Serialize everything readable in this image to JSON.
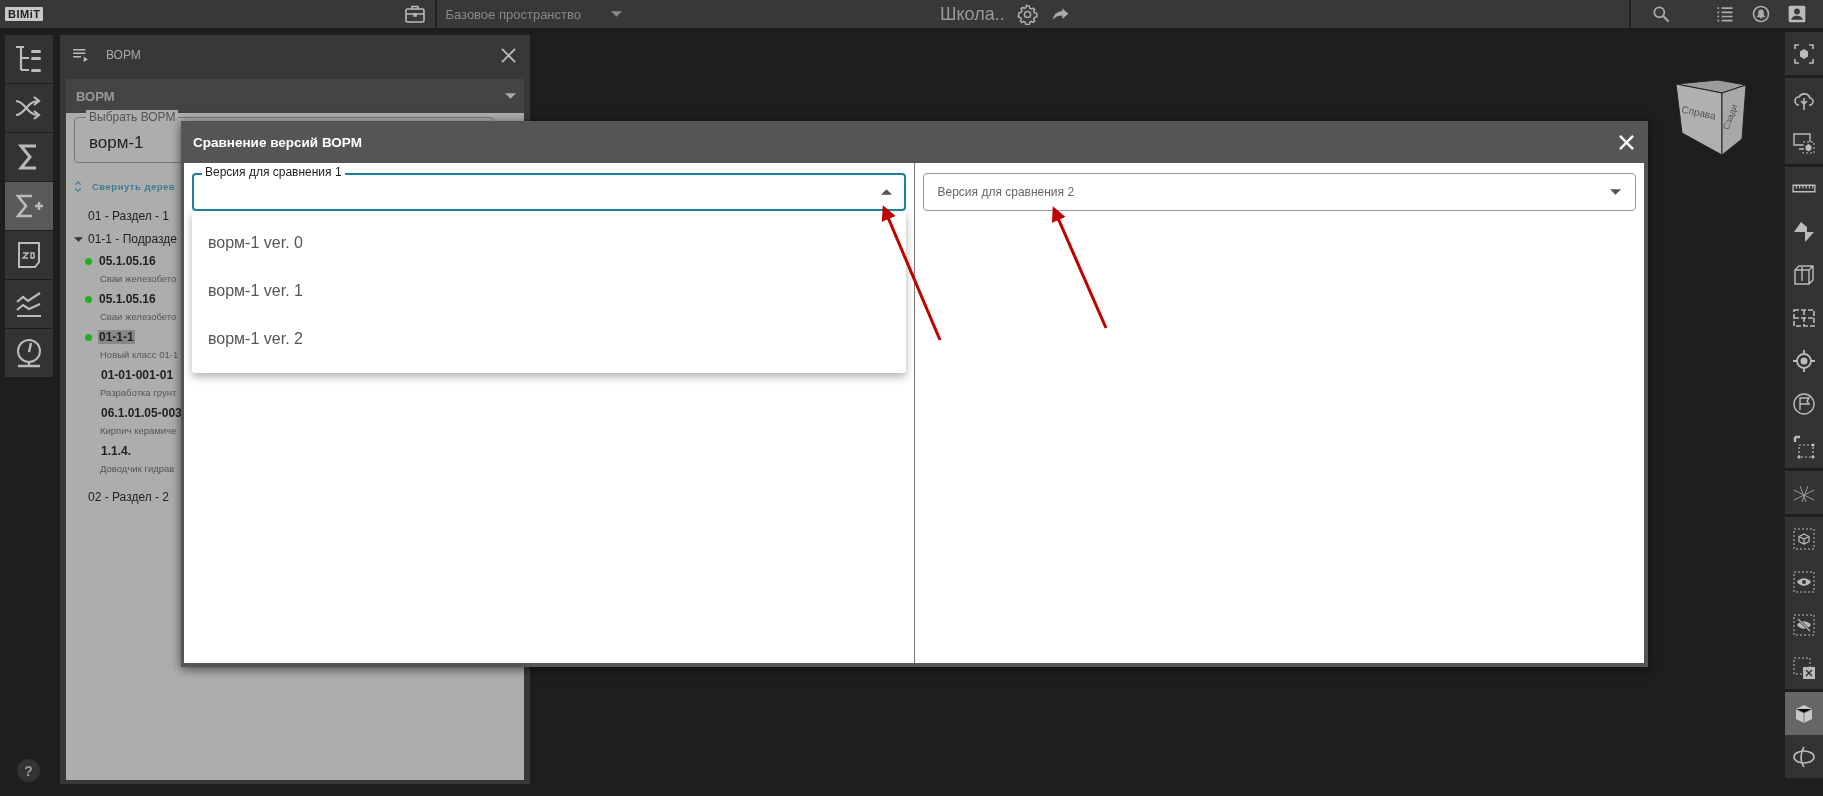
{
  "topbar": {
    "logo": "BIMiT",
    "workspace": "Базовое пространство",
    "project": "Школа.."
  },
  "left_rail": [
    {
      "kind": "tree",
      "selected": false
    },
    {
      "kind": "shuffle",
      "selected": false
    },
    {
      "kind": "sum",
      "selected": false
    },
    {
      "kind": "sumplus",
      "selected": true
    },
    {
      "kind": "plan2d",
      "selected": false
    },
    {
      "kind": "chart",
      "selected": false
    },
    {
      "kind": "gauge",
      "selected": false
    }
  ],
  "help": "?",
  "panel": {
    "title": "ВОРМ",
    "selector": "ВОРМ",
    "field_label": "Выбрать ВОРМ",
    "field_value": "ворм-1",
    "collapse_link": "Свернуть дерев",
    "tree": [
      {
        "kind": "section",
        "label": "01 - Раздел - 1"
      },
      {
        "kind": "group",
        "label": "01-1 - Подразде",
        "expanded": true,
        "children": [
          {
            "code": "05.1.05.16",
            "description": "Сваи железобето",
            "dot": true,
            "selected": false
          },
          {
            "code": "05.1.05.16",
            "description": "Сваи железобето",
            "dot": true,
            "selected": false
          },
          {
            "code": "01-1-1",
            "description": "Новый класс 01-1",
            "dot": true,
            "selected": true
          },
          {
            "code": "01-01-001-01",
            "description": "Разработка грунт",
            "dot": false,
            "selected": false
          },
          {
            "code": "06.1.01.05-003",
            "description": "Кирпич керамиче",
            "dot": false,
            "selected": false
          },
          {
            "code": "1.1.4.",
            "description": "Доводчик гидрав",
            "dot": false,
            "selected": false
          }
        ]
      },
      {
        "kind": "section",
        "label": "02 - Раздел - 2"
      }
    ]
  },
  "view_cube": {
    "faces": [
      "Справа",
      "Сзади"
    ]
  },
  "right_rail": [
    {
      "items": [
        {
          "kind": "focus"
        }
      ]
    },
    {
      "items": [
        {
          "kind": "cloud"
        },
        {
          "kind": "screen"
        }
      ]
    },
    {
      "items": [
        {
          "kind": "ruler"
        },
        {
          "kind": "section"
        },
        {
          "kind": "box"
        },
        {
          "kind": "plan"
        },
        {
          "kind": "target"
        },
        {
          "kind": "flag"
        },
        {
          "kind": "select"
        }
      ]
    },
    {
      "items": [
        {
          "kind": "grid"
        }
      ]
    },
    {
      "items": [
        {
          "kind": "cube"
        },
        {
          "kind": "eye"
        },
        {
          "kind": "eyeoff"
        },
        {
          "kind": "remove"
        }
      ]
    },
    {
      "items": [
        {
          "kind": "solid"
        },
        {
          "kind": "orbit"
        }
      ]
    }
  ],
  "dialog": {
    "title": "Сравнение версий ВОРМ",
    "left": {
      "label": "Версия для сравнения 1",
      "expanded": true,
      "options": [
        "ворм-1 ver. 0",
        "ворм-1 ver. 1",
        "ворм-1 ver. 2"
      ]
    },
    "right": {
      "placeholder": "Версия для сравнения 2",
      "expanded": false
    }
  }
}
